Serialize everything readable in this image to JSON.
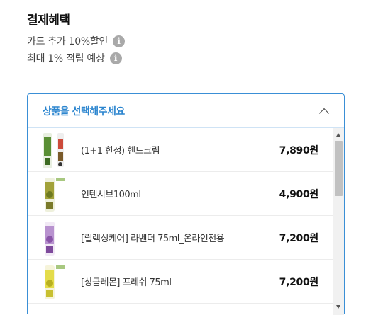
{
  "benefits": {
    "title": "결제혜택",
    "rows": [
      {
        "text": "카드 추가 10%할인",
        "icon": "info-icon"
      },
      {
        "text": "최대 1% 적립 예상",
        "icon": "info-icon"
      }
    ],
    "info_glyph": "i"
  },
  "selector": {
    "title": "상품을 선택해주세요",
    "toggle_icon": "chevron-up-icon",
    "items": [
      {
        "name": "(1+1 한정) 핸드크림",
        "price": "7,890원",
        "thumb_color": "#5a8f35"
      },
      {
        "name": "인텐시브100ml",
        "price": "4,900원",
        "thumb_color": "#9a9a2a"
      },
      {
        "name": "[릴렉싱케어] 라벤더 75ml_온라인전용",
        "price": "7,200원",
        "thumb_color": "#9a62b8"
      },
      {
        "name": "[상큼레몬] 프레쉬 75ml",
        "price": "7,200원",
        "thumb_color": "#d8d23a"
      }
    ]
  }
}
